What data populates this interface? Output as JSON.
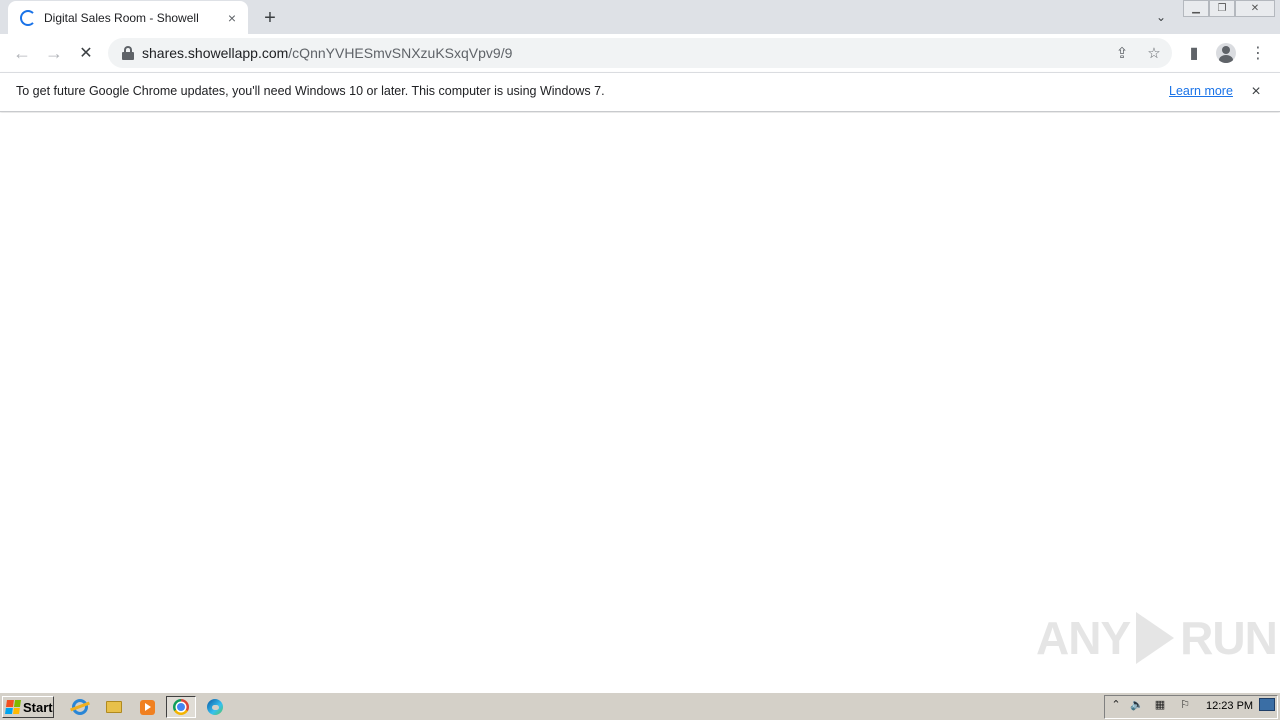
{
  "browser": {
    "tab": {
      "title": "Digital Sales Room - Showell"
    },
    "address": {
      "host": "shares.showellapp.com",
      "path": "/cQnnYVHESmvSNXzuKSxqVpv9/9"
    }
  },
  "infobar": {
    "message": "To get future Google Chrome updates, you'll need Windows 10 or later. This computer is using Windows 7.",
    "link_label": "Learn more"
  },
  "watermark": {
    "left": "ANY",
    "right": "RUN"
  },
  "taskbar": {
    "start_label": "Start",
    "clock": "12:23 PM"
  },
  "icons": {
    "close": "×",
    "new_tab": "+",
    "back": "←",
    "forward": "→",
    "stop": "✕",
    "share": "⇪",
    "star": "☆",
    "side_panel": "▮",
    "menu": "⋮",
    "tab_search": "⌄"
  }
}
